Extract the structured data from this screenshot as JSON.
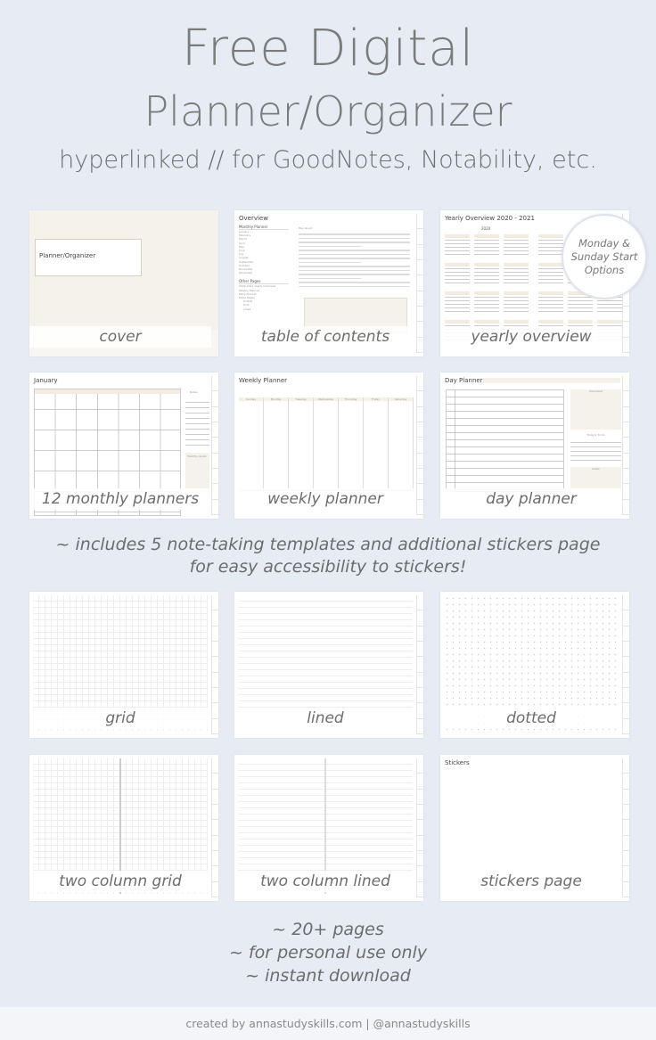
{
  "header": {
    "line1": "Free Digital",
    "line2": "Planner/Organizer",
    "line3": "hyperlinked // for GoodNotes, Notability, etc."
  },
  "badge": "Monday & Sunday Start Options",
  "cards": [
    {
      "id": "cover",
      "caption": "cover",
      "title": "Planner/Organizer"
    },
    {
      "id": "toc",
      "caption": "table of contents",
      "title": "Overview",
      "section1": "Monthly Planner",
      "months": [
        "January",
        "February",
        "March",
        "April",
        "May",
        "June",
        "July",
        "August",
        "September",
        "October",
        "November",
        "December"
      ],
      "section2": "Other Pages",
      "other": [
        "2020-2021 Yearly Overview",
        "Weekly Planner",
        "Daily Planner",
        "Extra Pages",
        "Dotted",
        "Grid",
        "Lined"
      ],
      "greeting": "Hey Guys!"
    },
    {
      "id": "yearly",
      "caption": "yearly overview",
      "title": "Yearly Overview 2020 - 2021",
      "year": "2020"
    },
    {
      "id": "monthly",
      "caption": "12 monthly planners",
      "title": "January",
      "notes": "Notes",
      "goals": "Monthly Goals"
    },
    {
      "id": "weekly",
      "caption": "weekly planner",
      "title": "Weekly Planner",
      "days": [
        "Sunday",
        "Monday",
        "Tuesday",
        "Wednesday",
        "Thursday",
        "Friday",
        "Saturday"
      ]
    },
    {
      "id": "day",
      "caption": "day planner",
      "title": "Day Planner",
      "important": "Important",
      "todo": "Today's To Do",
      "goals": "Goals"
    },
    {
      "id": "grid",
      "caption": "grid"
    },
    {
      "id": "lined",
      "caption": "lined"
    },
    {
      "id": "dotted",
      "caption": "dotted"
    },
    {
      "id": "twogrid",
      "caption": "two column grid"
    },
    {
      "id": "twolined",
      "caption": "two column lined"
    },
    {
      "id": "stickers",
      "caption": "stickers page",
      "title": "Stickers"
    }
  ],
  "middle": {
    "line1": "~ includes 5 note-taking templates and additional stickers page",
    "line2": "for easy accessibility to stickers!"
  },
  "bottom": [
    "~ 20+ pages",
    "~ for personal use only",
    "~ instant download"
  ],
  "footer": "created by annastudyskills.com | @annastudyskills"
}
